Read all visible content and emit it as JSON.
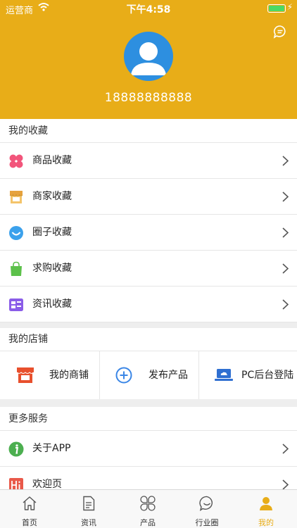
{
  "status_bar": {
    "carrier": "运营商",
    "time": "下午4:58",
    "battery_level": 1.0
  },
  "profile": {
    "phone": "18888888888"
  },
  "colors": {
    "accent": "#e8ad18",
    "battery": "#4cd964",
    "avatar_bg": "#2d8fe0"
  },
  "favorites": {
    "title": "我的收藏",
    "items": [
      {
        "label": "商品收藏",
        "icon": "clover-icon"
      },
      {
        "label": "商家收藏",
        "icon": "storefront-icon"
      },
      {
        "label": "圈子收藏",
        "icon": "smile-circle-icon"
      },
      {
        "label": "求购收藏",
        "icon": "shopping-bag-icon"
      },
      {
        "label": "资讯收藏",
        "icon": "news-card-icon"
      }
    ]
  },
  "shop": {
    "title": "我的店铺",
    "items": [
      {
        "label": "我的商铺",
        "icon": "shop-icon"
      },
      {
        "label": "发布产品",
        "icon": "plus-circle-icon"
      },
      {
        "label": "PC后台登陆",
        "icon": "laptop-cloud-icon"
      }
    ]
  },
  "more": {
    "title": "更多服务",
    "items": [
      {
        "label": "关于APP",
        "icon": "info-icon"
      },
      {
        "label": "欢迎页",
        "icon": "hi-icon"
      }
    ]
  },
  "tabs": [
    {
      "label": "首页",
      "icon": "home-icon"
    },
    {
      "label": "资讯",
      "icon": "document-icon"
    },
    {
      "label": "产品",
      "icon": "grid-petals-icon"
    },
    {
      "label": "行业圈",
      "icon": "chat-bubble-icon"
    },
    {
      "label": "我的",
      "icon": "person-icon",
      "active": true
    }
  ]
}
